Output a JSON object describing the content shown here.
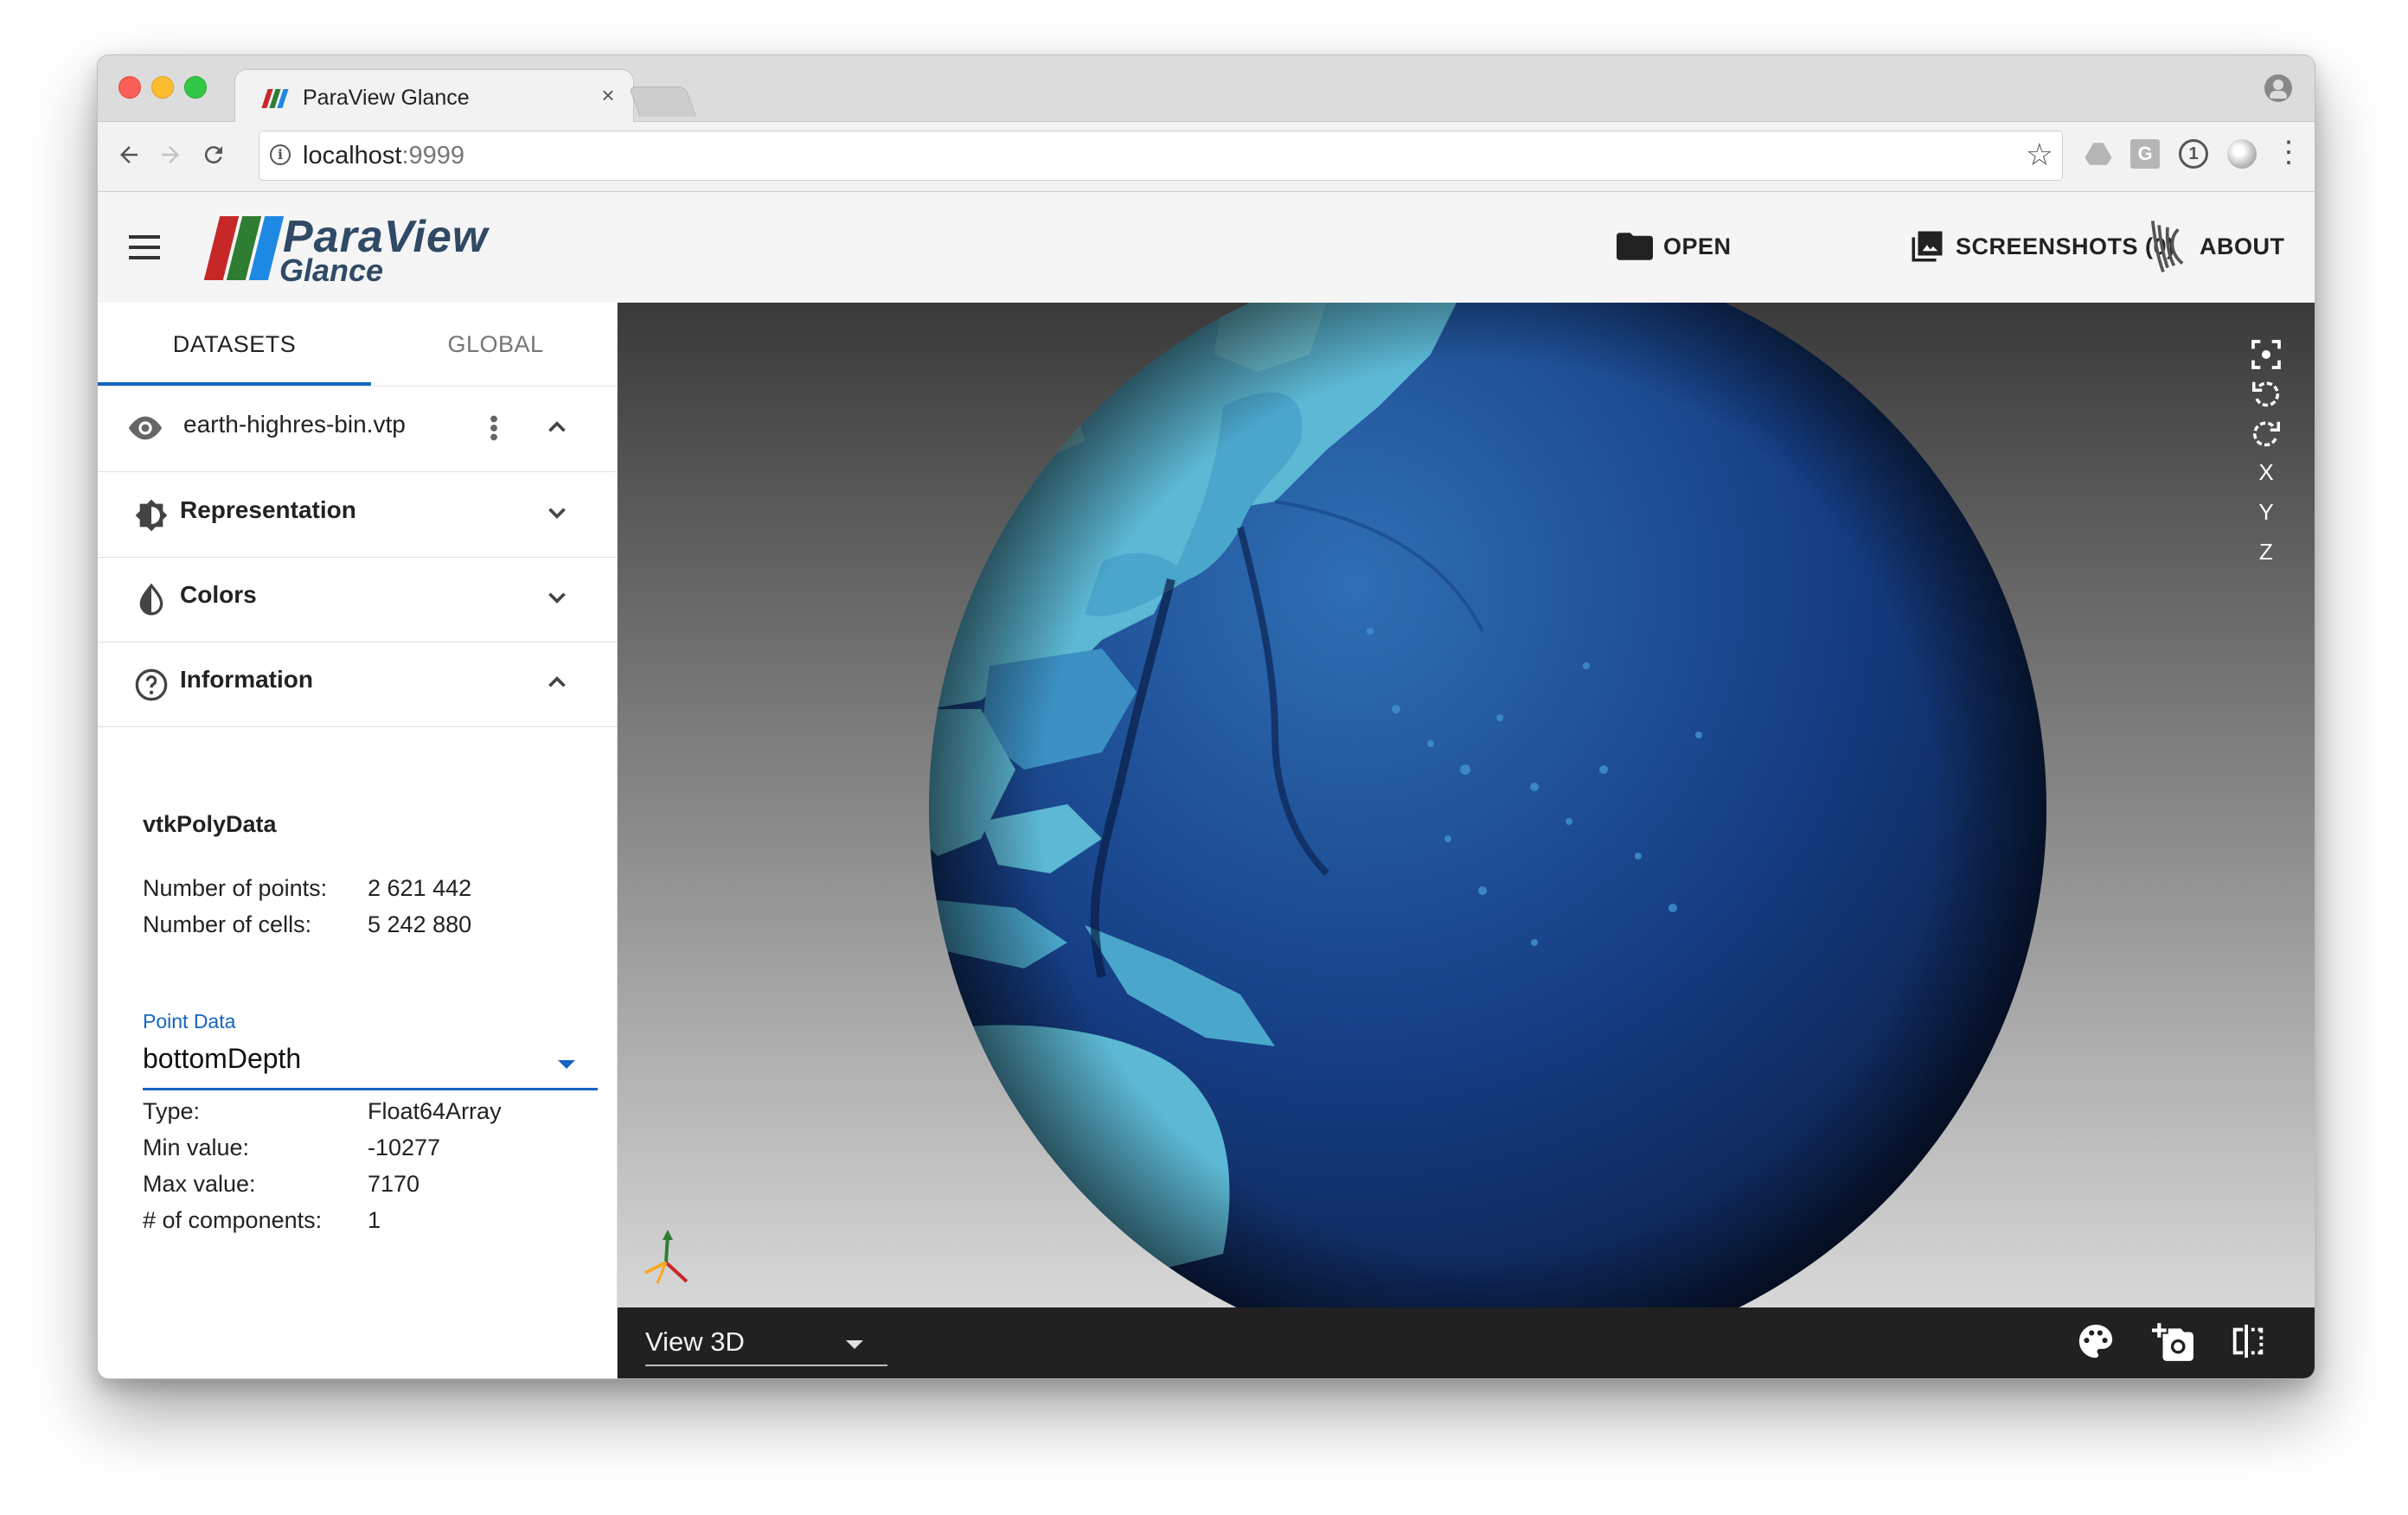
{
  "browser": {
    "tab_title": "ParaView Glance",
    "tab_close": "×",
    "url_host": "localhost",
    "url_port": ":9999",
    "extension_g": "G",
    "extension_onepassword": "1"
  },
  "header": {
    "logo_line1": "ParaView",
    "logo_line2": "Glance",
    "open_label": "OPEN",
    "screenshots_label": "SCREENSHOTS (0)",
    "about_label": "ABOUT"
  },
  "panel": {
    "tabs": [
      {
        "label": "DATASETS",
        "active": true
      },
      {
        "label": "GLOBAL",
        "active": false
      }
    ],
    "dataset_name": "earth-highres-bin.vtp",
    "sections": [
      {
        "label": "Representation",
        "expanded": false
      },
      {
        "label": "Colors",
        "expanded": false
      },
      {
        "label": "Information",
        "expanded": true
      }
    ],
    "info": {
      "type_name": "vtkPolyData",
      "points_label": "Number of points:",
      "points_value": "2 621 442",
      "cells_label": "Number of cells:",
      "cells_value": "5 242 880",
      "point_data_label": "Point Data",
      "array_name": "bottomDepth",
      "array_type_label": "Type:",
      "array_type_value": "Float64Array",
      "min_label": "Min value:",
      "min_value": "-10277",
      "max_label": "Max value:",
      "max_value": "7170",
      "components_label": "# of components:",
      "components_value": "1"
    }
  },
  "view": {
    "tools": [
      "reset-camera-icon",
      "rotate-left-icon",
      "rotate-right-icon",
      "X",
      "Y",
      "Z"
    ],
    "view_type": "View 3D",
    "bottom_icons": [
      "palette-icon",
      "add-screenshot-icon",
      "split-view-icon"
    ]
  },
  "colors": {
    "accent": "#1565c0",
    "logo_red": "#c62828",
    "logo_green": "#2e7d32",
    "logo_blue": "#1e88e5",
    "ocean_deep": "#0c2f66",
    "ocean_shelf": "#3d8fc0",
    "land": "#6fc3d8"
  }
}
